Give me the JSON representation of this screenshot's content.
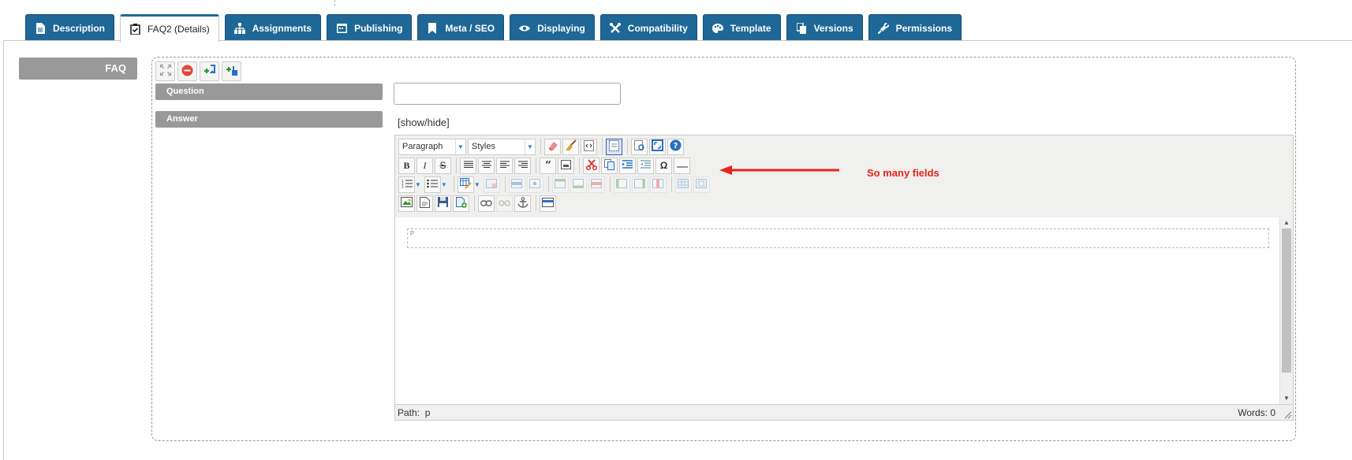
{
  "tabs": [
    {
      "label": "Description",
      "icon": "document-icon",
      "active": false
    },
    {
      "label": "FAQ2 (Details)",
      "icon": "clipboard-check-icon",
      "active": true
    },
    {
      "label": "Assignments",
      "icon": "sitemap-icon",
      "active": false
    },
    {
      "label": "Publishing",
      "icon": "calendar-icon",
      "active": false
    },
    {
      "label": "Meta / SEO",
      "icon": "bookmark-icon",
      "active": false
    },
    {
      "label": "Displaying",
      "icon": "eye-icon",
      "active": false
    },
    {
      "label": "Compatibility",
      "icon": "wrench-icon",
      "active": false
    },
    {
      "label": "Template",
      "icon": "palette-icon",
      "active": false
    },
    {
      "label": "Versions",
      "icon": "copy-icon",
      "active": false
    },
    {
      "label": "Permissions",
      "icon": "plug-icon",
      "active": false
    }
  ],
  "faq": {
    "label": "FAQ",
    "question_label": "Question",
    "answer_label": "Answer",
    "question_value": "",
    "show_hide": "[show/hide]"
  },
  "editor": {
    "format_select": "Paragraph",
    "styles_select": "Styles",
    "block_marker": "P",
    "path_label": "Path:",
    "path_value": "p",
    "words": "Words: 0",
    "bold_glyph": "B",
    "italic_glyph": "I",
    "strike_glyph": "S",
    "omega_glyph": "Ω"
  },
  "annotation": {
    "text": "So many fields",
    "color": "#e8231c"
  },
  "colors": {
    "tab_bg": "#1e6796",
    "label_bg": "#999999"
  }
}
